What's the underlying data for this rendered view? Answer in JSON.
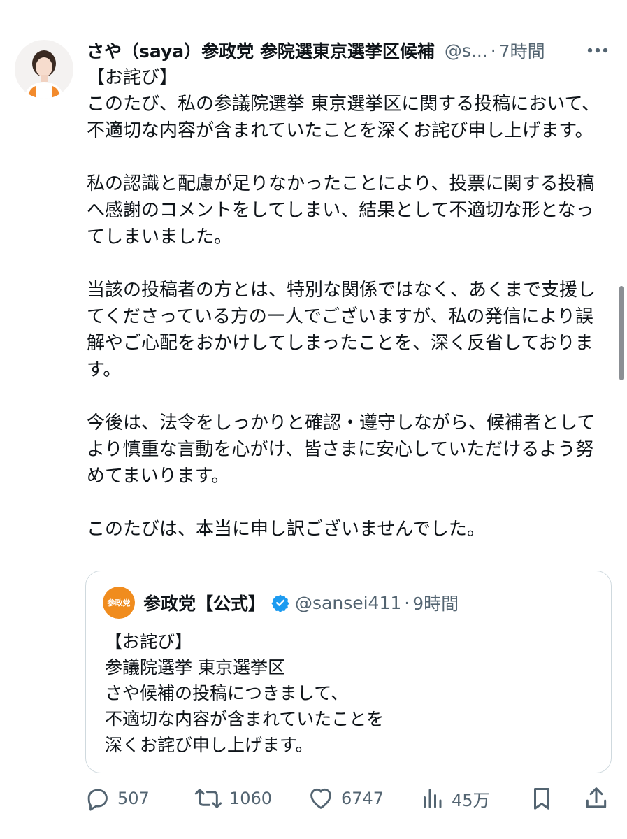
{
  "tweet": {
    "author_name": "さや（saya）参政党 参院選東京選挙区候補",
    "author_handle": "@s...",
    "separator": "·",
    "time": "7時間",
    "paragraphs": [
      "【お詫び】\nこのたび、私の参議院選挙 東京選挙区に関する投稿において、不適切な内容が含まれていたことを深くお詫び申し上げます。",
      "私の認識と配慮が足りなかったことにより、投票に関する投稿へ感謝のコメントをしてしまい、結果として不適切な形となってしまいました。",
      "当該の投稿者の方とは、特別な関係ではなく、あくまで支援してくださっている方の一人でございますが、私の発信により誤解やご心配をおかけしてしまったことを、深く反省しております。",
      "今後は、法令をしっかりと確認・遵守しながら、候補者としてより慎重な言動を心がけ、皆さまに安心していただけるよう努めてまいります。",
      "このたびは、本当に申し訳ございませんでした。"
    ]
  },
  "quote": {
    "author_name": "参政党【公式】",
    "author_handle": "@sansei411",
    "separator": "·",
    "time": "9時間",
    "logo_text": "参政党",
    "text": "【お詫び】\n参議院選挙 東京選挙区\nさや候補の投稿につきまして、\n不適切な内容が含まれていたことを\n深くお詫び申し上げます。"
  },
  "actions": {
    "replies": "507",
    "retweets": "1060",
    "likes": "6747",
    "views": "45万"
  },
  "colors": {
    "text": "#0f1419",
    "secondary": "#536471",
    "border": "#cfd9de",
    "verified": "#1d9bf0",
    "party_orange": "#f08c1e"
  },
  "icons": {
    "more": "more-horizontal-icon",
    "reply": "reply-icon",
    "retweet": "retweet-icon",
    "like": "heart-icon",
    "views": "views-icon",
    "bookmark": "bookmark-icon",
    "share": "share-icon",
    "verified": "verified-badge-icon"
  }
}
